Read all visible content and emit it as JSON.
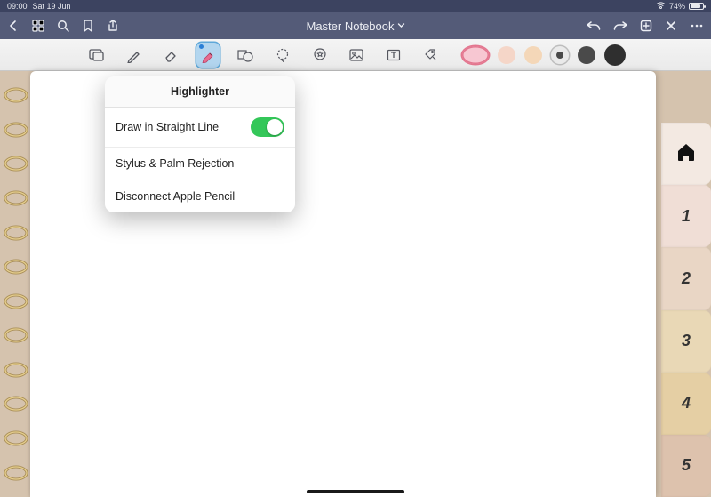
{
  "status": {
    "time": "09:00",
    "date": "Sat 19 Jun",
    "battery_pct": "74%"
  },
  "nav": {
    "title": "Master Notebook"
  },
  "popover": {
    "title": "Highlighter",
    "rows": {
      "straight": "Draw in Straight Line",
      "palm": "Stylus & Palm Rejection",
      "disconnect": "Disconnect Apple Pencil"
    }
  },
  "tabs": [
    "1",
    "2",
    "3",
    "4",
    "5"
  ],
  "tab_colors": [
    "#f0ded6",
    "#e9d6c5",
    "#e9d8b6",
    "#e5cfa4",
    "#ddc2ad"
  ],
  "home_tab_color": "#f3e9e2",
  "colors": {
    "c1": "#f7c7d2",
    "c2": "#f5d6c8",
    "c3": "#f4d7b8",
    "sel_bg": "#eaeaea",
    "c5": "#4a4a4a",
    "c6": "#2f2f2f"
  }
}
